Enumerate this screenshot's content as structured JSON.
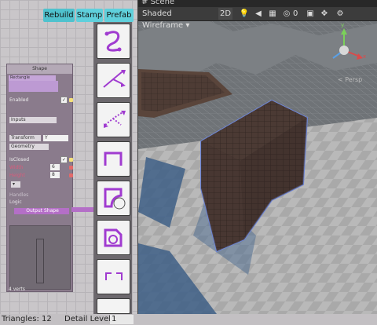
{
  "toolbar": {
    "rebuild_label": "Rebuild",
    "stamp_label": "Stamp",
    "prefab_label": "Prefab"
  },
  "node": {
    "title": "Shape",
    "primitive_label": "Rectangle",
    "enabled_label": "Enabled",
    "inputs_label": "Inputs",
    "transform_label": "Transform",
    "transform_value": "Y",
    "geometry_label": "Geometry",
    "isclosed_label": "IsClosed",
    "width_label": "Width",
    "width_value": "6",
    "height_label": "Height",
    "height_value": "8",
    "handles_label": "Handles",
    "logic_label": "Logic",
    "output_label": "Output Shape",
    "verts_label": "4 verts"
  },
  "status": {
    "triangles_label": "Triangles: 12",
    "detail_label": "Detail Level",
    "detail_value": "1"
  },
  "scene": {
    "tab_label": "Scene",
    "shading_label": "Shaded Wireframe",
    "mode_2d_label": "2D",
    "gizmo_count": "0",
    "persp_label": "< Persp"
  },
  "icons": [
    "bezier-curve-icon",
    "branch-curve-icon",
    "branch-dots-icon",
    "path-corner-icon",
    "rounded-square-icon",
    "rotate-shape-icon",
    "corner-pieces-icon"
  ],
  "colors": {
    "accent_cyan": "#5fd0dc",
    "purple": "#b46fc7",
    "slot_yellow": "#f4e07a"
  }
}
